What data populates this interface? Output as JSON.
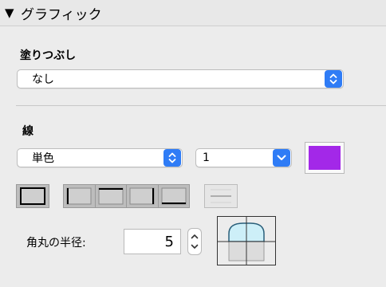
{
  "header": {
    "disclosure": "▼",
    "title": "グラフィック"
  },
  "fill": {
    "label": "塗りつぶし",
    "value": "なし"
  },
  "stroke": {
    "label": "線",
    "type_value": "単色",
    "width_value": "1",
    "color": "#a328e8"
  },
  "border_style_icons": [
    "border-all-icon",
    "border-left-top-icon",
    "border-top-right-icon",
    "border-right-icon",
    "border-bottom-icon",
    "border-horizontal-icon"
  ],
  "corner": {
    "label": "角丸の半径:",
    "value": "5"
  },
  "colors": {
    "accent": "#2f7cf6",
    "background": "#ececec",
    "preview_fill": "#cdeff8"
  }
}
